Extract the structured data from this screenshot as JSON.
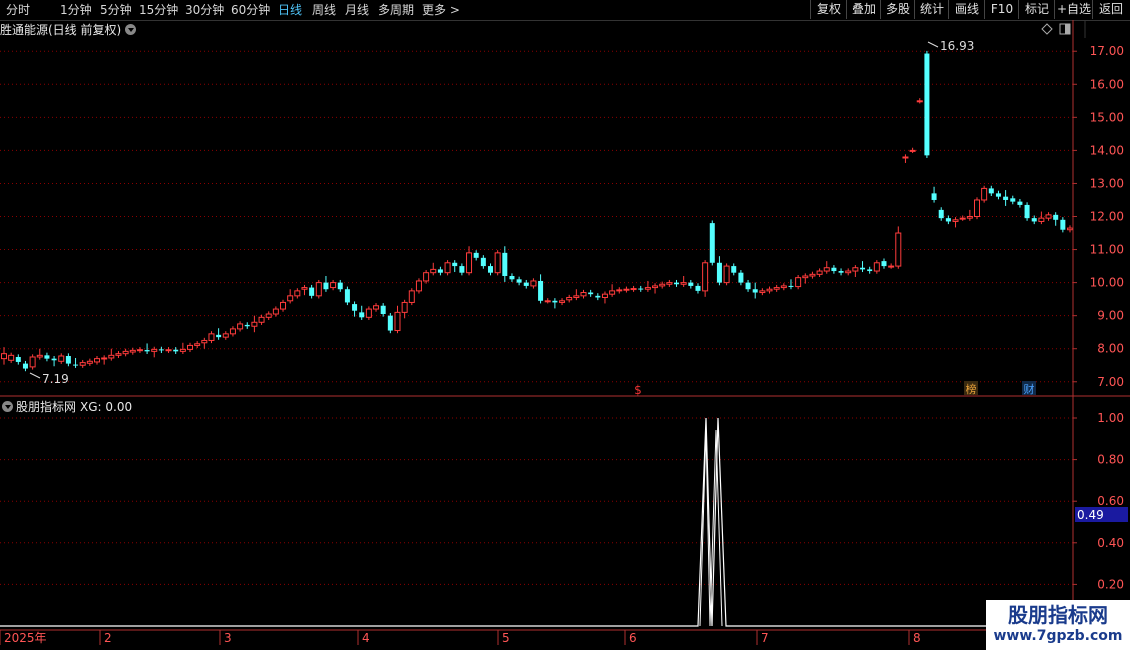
{
  "toolbar": {
    "periods": [
      "分时",
      "1分钟",
      "5分钟",
      "15分钟",
      "30分钟",
      "60分钟",
      "日线",
      "周线",
      "月线",
      "多周期",
      "更多 >"
    ],
    "active_period": "日线",
    "right_buttons": [
      "复权",
      "叠加",
      "多股",
      "统计",
      "画线",
      "F10",
      "标记",
      "+自选",
      "返回"
    ]
  },
  "stock": {
    "title": "胜通能源(日线 前复权)"
  },
  "main_chart": {
    "y_ticks": [
      "17.00",
      "16.00",
      "15.00",
      "14.00",
      "13.00",
      "12.00",
      "11.00",
      "10.00",
      "9.00",
      "8.00",
      "7.00"
    ],
    "y_min": 6.6,
    "y_max": 17.4,
    "high_label": "16.93",
    "low_label": "7.19",
    "markers": [
      {
        "text": "$",
        "color": "#e33"
      },
      {
        "text": "榜",
        "color": "#e8a23a"
      },
      {
        "text": "财",
        "color": "#4aa3ff"
      }
    ]
  },
  "indicator": {
    "name": "股朋指标网",
    "value_text": "XG: 0.00",
    "y_ticks": [
      "1.00",
      "0.80",
      "0.60",
      "0.40",
      "0.20"
    ],
    "current_value": "0.49"
  },
  "x_axis": {
    "labels": [
      "2025年",
      "2",
      "3",
      "4",
      "5",
      "6",
      "7",
      "8"
    ]
  },
  "watermark": {
    "line1": "股朋指标网",
    "line2": "www.7gpzb.com"
  },
  "colors": {
    "up": "#ff3c3c",
    "down": "#54ffff",
    "grid": "#8b0000",
    "axis": "#b03030",
    "active": "#4fc3f7"
  }
}
